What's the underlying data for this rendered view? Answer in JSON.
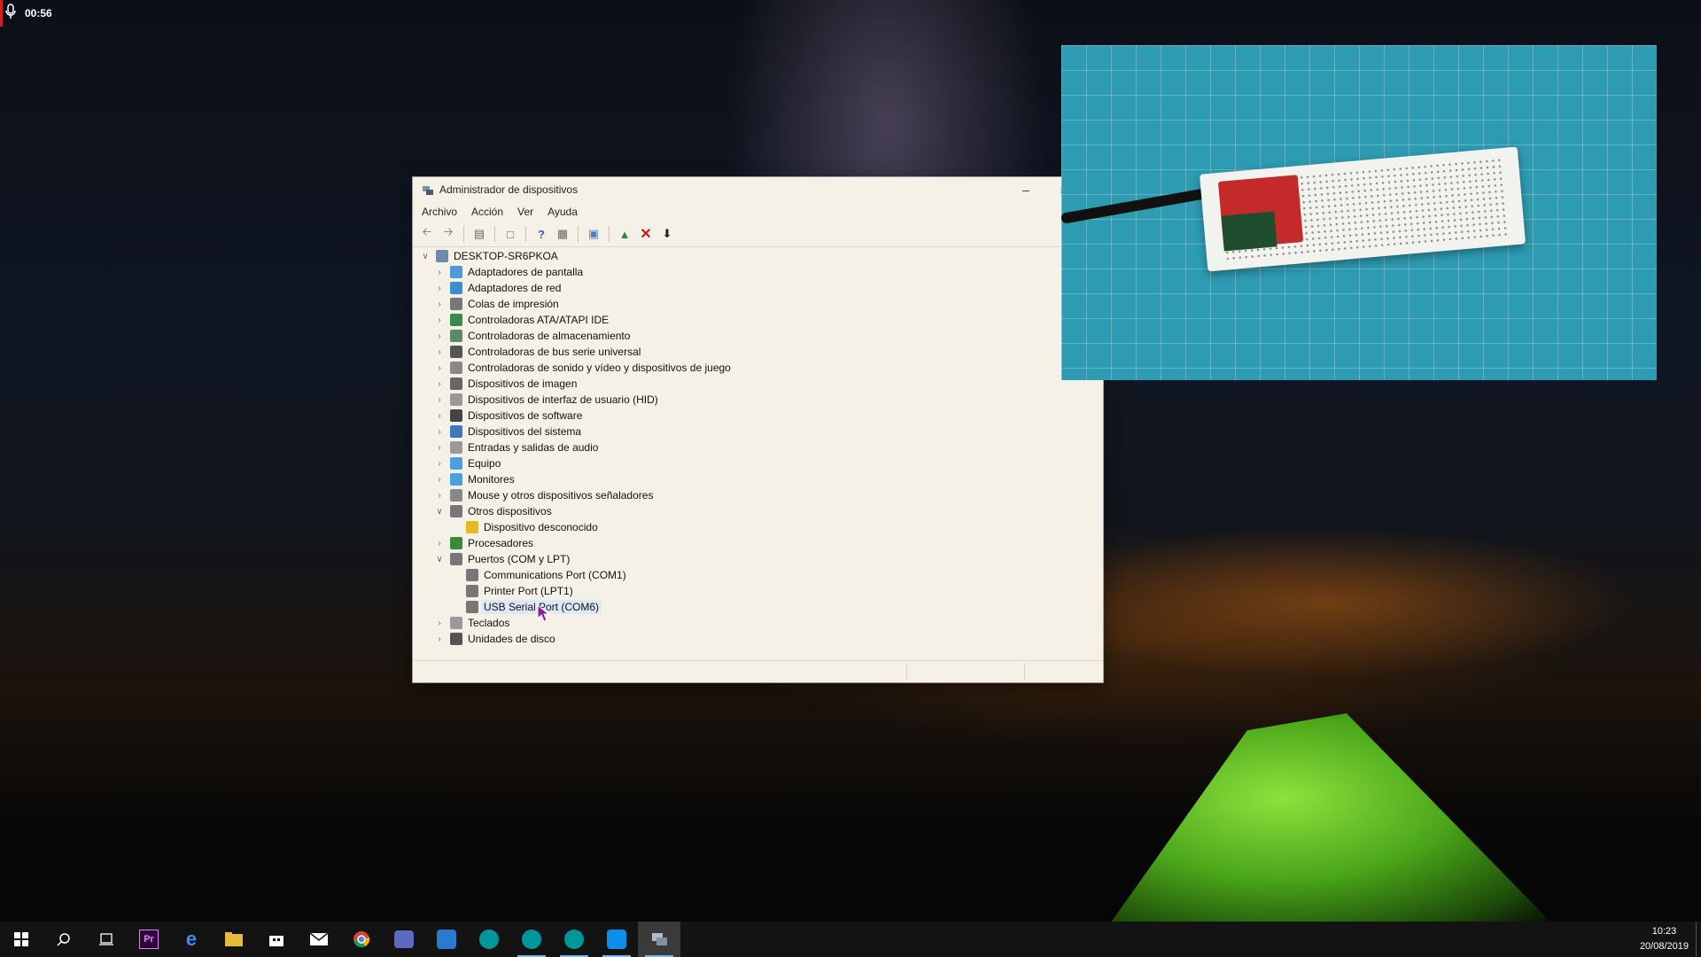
{
  "recording": {
    "time": "00:56",
    "icon": "microphone-icon"
  },
  "window": {
    "title": "Administrador de dispositivos",
    "menu": [
      "Archivo",
      "Acción",
      "Ver",
      "Ayuda"
    ],
    "tree": {
      "root": "DESKTOP-SR6PKOA",
      "items": [
        {
          "label": "Adaptadores de pantalla",
          "expanded": false
        },
        {
          "label": "Adaptadores de red",
          "expanded": false
        },
        {
          "label": "Colas de impresión",
          "expanded": false
        },
        {
          "label": "Controladoras ATA/ATAPI IDE",
          "expanded": false
        },
        {
          "label": "Controladoras de almacenamiento",
          "expanded": false
        },
        {
          "label": "Controladoras de bus serie universal",
          "expanded": false
        },
        {
          "label": "Controladoras de sonido y vídeo y dispositivos de juego",
          "expanded": false
        },
        {
          "label": "Dispositivos de imagen",
          "expanded": false
        },
        {
          "label": "Dispositivos de interfaz de usuario (HID)",
          "expanded": false
        },
        {
          "label": "Dispositivos de software",
          "expanded": false
        },
        {
          "label": "Dispositivos del sistema",
          "expanded": false
        },
        {
          "label": "Entradas y salidas de audio",
          "expanded": false
        },
        {
          "label": "Equipo",
          "expanded": false
        },
        {
          "label": "Monitores",
          "expanded": false
        },
        {
          "label": "Mouse y otros dispositivos señaladores",
          "expanded": false
        },
        {
          "label": "Otros dispositivos",
          "expanded": true
        },
        {
          "label": "Dispositivo desconocido",
          "child": true
        },
        {
          "label": "Procesadores",
          "expanded": false
        },
        {
          "label": "Puertos (COM y LPT)",
          "expanded": true
        },
        {
          "label": "Communications Port (COM1)",
          "child": true
        },
        {
          "label": "Printer Port (LPT1)",
          "child": true
        },
        {
          "label": "USB Serial Port (COM6)",
          "child": true,
          "selected": true
        },
        {
          "label": "Teclados",
          "expanded": false
        },
        {
          "label": "Unidades de disco",
          "expanded": false
        }
      ]
    }
  },
  "taskbar": {
    "icons": [
      "windows-start-icon",
      "search-icon",
      "task-view-icon",
      "premiere-pro-icon",
      "edge-icon",
      "file-explorer-icon",
      "store-icon",
      "mail-icon",
      "chrome-icon",
      "cloud-app-icon",
      "whatsapp-icon",
      "arduino-icon",
      "arduino-icon-2",
      "arduino-icon-3",
      "teamviewer-icon",
      "device-manager-icon"
    ],
    "premiere_label": "Pr",
    "time": "10:23",
    "date": "20/08/2019"
  }
}
